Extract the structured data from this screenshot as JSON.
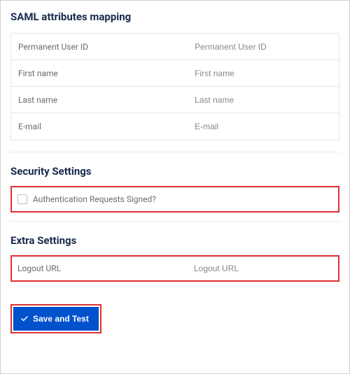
{
  "saml_mapping": {
    "title": "SAML attributes mapping",
    "rows": [
      {
        "label": "Permanent User ID",
        "placeholder": "Permanent User ID"
      },
      {
        "label": "First name",
        "placeholder": "First name"
      },
      {
        "label": "Last name",
        "placeholder": "Last name"
      },
      {
        "label": "E-mail",
        "placeholder": "E-mail"
      }
    ]
  },
  "security": {
    "title": "Security Settings",
    "auth_signed_label": "Authentication Requests Signed?"
  },
  "extra": {
    "title": "Extra Settings",
    "logout_label": "Logout URL",
    "logout_placeholder": "Logout URL"
  },
  "actions": {
    "save_label": "Save and Test"
  }
}
